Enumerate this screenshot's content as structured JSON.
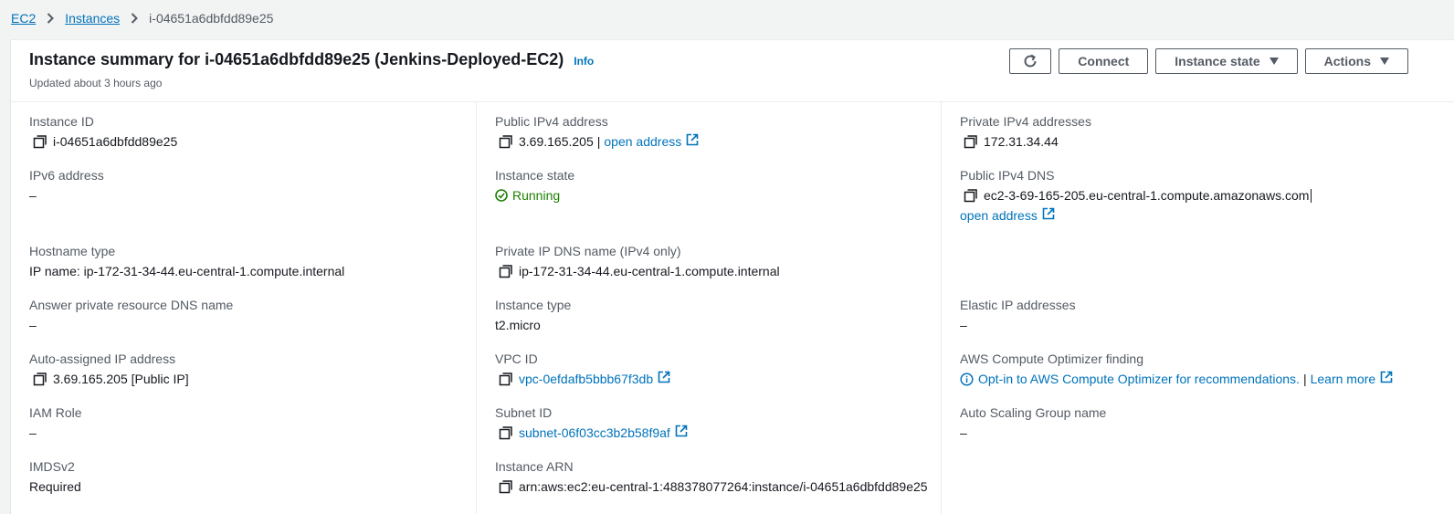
{
  "breadcrumb": {
    "ec2": "EC2",
    "instances": "Instances",
    "current": "i-04651a6dbfdd89e25"
  },
  "header": {
    "title": "Instance summary for i-04651a6dbfdd89e25 (Jenkins-Deployed-EC2)",
    "info": "Info",
    "updated": "Updated about 3 hours ago",
    "connect": "Connect",
    "instance_state": "Instance state",
    "actions": "Actions"
  },
  "col1": {
    "instance_id_label": "Instance ID",
    "instance_id": "i-04651a6dbfdd89e25",
    "ipv6_label": "IPv6 address",
    "ipv6": "–",
    "hostname_type_label": "Hostname type",
    "hostname_type": "IP name: ip-172-31-34-44.eu-central-1.compute.internal",
    "answer_dns_label": "Answer private resource DNS name",
    "answer_dns": "–",
    "auto_ip_label": "Auto-assigned IP address",
    "auto_ip": "3.69.165.205 [Public IP]",
    "iam_label": "IAM Role",
    "iam": "–",
    "imds_label": "IMDSv2",
    "imds": "Required"
  },
  "col2": {
    "public_ipv4_label": "Public IPv4 address",
    "public_ipv4": "3.69.165.205",
    "public_ipv4_sep": "|",
    "open_address": "open address",
    "state_label": "Instance state",
    "state": "Running",
    "private_dns_label": "Private IP DNS name (IPv4 only)",
    "private_dns": "ip-172-31-34-44.eu-central-1.compute.internal",
    "type_label": "Instance type",
    "type": "t2.micro",
    "vpc_label": "VPC ID",
    "vpc": "vpc-0efdafb5bbb67f3db",
    "subnet_label": "Subnet ID",
    "subnet": "subnet-06f03cc3b2b58f9af",
    "arn_label": "Instance ARN",
    "arn": "arn:aws:ec2:eu-central-1:488378077264:instance/i-04651a6dbfdd89e25"
  },
  "col3": {
    "private_ipv4_label": "Private IPv4 addresses",
    "private_ipv4": "172.31.34.44",
    "public_dns_label": "Public IPv4 DNS",
    "public_dns": "ec2-3-69-165-205.eu-central-1.compute.amazonaws.com",
    "open_address": "open address",
    "elastic_label": "Elastic IP addresses",
    "elastic": "–",
    "optimizer_label": "AWS Compute Optimizer finding",
    "optimizer_link": "Opt-in to AWS Compute Optimizer for recommendations.",
    "optimizer_sep": "|",
    "learn_more": "Learn more",
    "asg_label": "Auto Scaling Group name",
    "asg": "–"
  },
  "colors": {
    "link": "#0073bb",
    "success": "#1d8102",
    "text": "#16191f",
    "muted": "#545b64"
  }
}
